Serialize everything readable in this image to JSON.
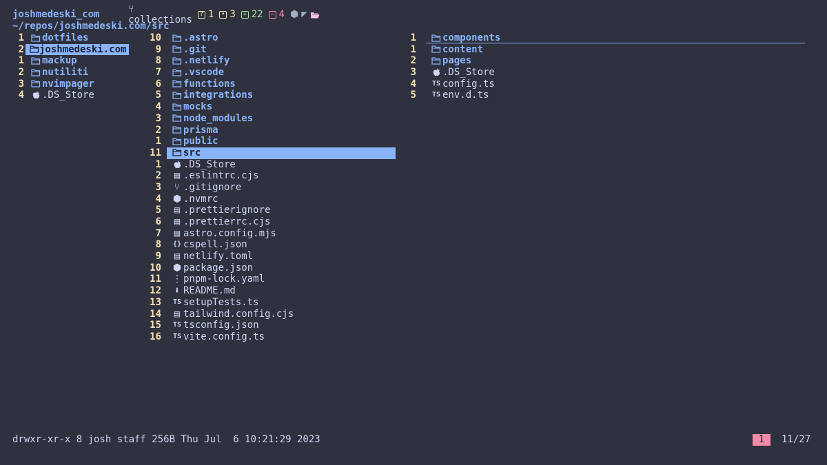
{
  "header": {
    "user_host": "joshmedeski_com",
    "branch_icon": "git-branch-icon",
    "branch": "collections",
    "stats": [
      {
        "icon": "untracked-icon",
        "value": "1",
        "color": "#f9e2af"
      },
      {
        "icon": "modified-icon",
        "value": "3",
        "color": "#f9e2af"
      },
      {
        "icon": "added-icon",
        "value": "22",
        "color": "#a6e3a1"
      },
      {
        "icon": "deleted-icon",
        "value": "4",
        "color": "#f38ba8"
      }
    ],
    "extra_icons": [
      "node-icon",
      "vite-icon",
      "folder-open-icon"
    ]
  },
  "path": "~/repos/joshmedeski.com/src",
  "parent_column": {
    "items": [
      {
        "num": "1",
        "icon": "folder",
        "name": "dotfiles",
        "type": "dir"
      },
      {
        "num": "2",
        "icon": "folder",
        "name": "joshmedeski.com",
        "type": "dir",
        "selected": true
      },
      {
        "num": "1",
        "icon": "folder",
        "name": "mackup",
        "type": "dir"
      },
      {
        "num": "2",
        "icon": "folder",
        "name": "nutiliti",
        "type": "dir"
      },
      {
        "num": "3",
        "icon": "folder",
        "name": "nvimpager",
        "type": "dir"
      },
      {
        "num": "4",
        "icon": "apple",
        "name": ".DS_Store",
        "type": "file"
      }
    ]
  },
  "current_column": {
    "items": [
      {
        "num": "10",
        "icon": "folder",
        "name": ".astro",
        "type": "dir"
      },
      {
        "num": "9",
        "icon": "folder",
        "name": ".git",
        "type": "dir"
      },
      {
        "num": "8",
        "icon": "folder",
        "name": ".netlify",
        "type": "dir"
      },
      {
        "num": "7",
        "icon": "folder",
        "name": ".vscode",
        "type": "dir"
      },
      {
        "num": "6",
        "icon": "folder",
        "name": "functions",
        "type": "dir"
      },
      {
        "num": "5",
        "icon": "folder",
        "name": "integrations",
        "type": "dir"
      },
      {
        "num": "4",
        "icon": "folder",
        "name": "mocks",
        "type": "dir"
      },
      {
        "num": "3",
        "icon": "folder",
        "name": "node_modules",
        "type": "dir"
      },
      {
        "num": "2",
        "icon": "folder",
        "name": "prisma",
        "type": "dir"
      },
      {
        "num": "1",
        "icon": "folder",
        "name": "public",
        "type": "dir"
      },
      {
        "num": "11",
        "icon": "folder",
        "name": "src",
        "type": "dir",
        "selected": true
      },
      {
        "num": "1",
        "icon": "apple",
        "name": ".DS_Store",
        "type": "file"
      },
      {
        "num": "2",
        "icon": "file",
        "name": ".eslintrc.cjs",
        "type": "file"
      },
      {
        "num": "3",
        "icon": "git",
        "name": ".gitignore",
        "type": "file"
      },
      {
        "num": "4",
        "icon": "node",
        "name": ".nvmrc",
        "type": "file"
      },
      {
        "num": "5",
        "icon": "file",
        "name": ".prettierignore",
        "type": "file"
      },
      {
        "num": "6",
        "icon": "file",
        "name": ".prettierrc.cjs",
        "type": "file"
      },
      {
        "num": "7",
        "icon": "file",
        "name": "astro.config.mjs",
        "type": "file"
      },
      {
        "num": "8",
        "icon": "json",
        "name": "cspell.json",
        "type": "file"
      },
      {
        "num": "9",
        "icon": "file",
        "name": "netlify.toml",
        "type": "file"
      },
      {
        "num": "10",
        "icon": "node",
        "name": "package.json",
        "type": "file"
      },
      {
        "num": "11",
        "icon": "yaml",
        "name": "pnpm-lock.yaml",
        "type": "file"
      },
      {
        "num": "12",
        "icon": "markdown",
        "name": "README.md",
        "type": "file"
      },
      {
        "num": "13",
        "icon": "ts",
        "name": "setupTests.ts",
        "type": "file"
      },
      {
        "num": "14",
        "icon": "file",
        "name": "tailwind.config.cjs",
        "type": "file"
      },
      {
        "num": "15",
        "icon": "ts",
        "name": "tsconfig.json",
        "type": "file"
      },
      {
        "num": "16",
        "icon": "ts",
        "name": "vite.config.ts",
        "type": "file"
      }
    ]
  },
  "preview_column": {
    "items": [
      {
        "num": "1",
        "icon": "folder",
        "name": "components",
        "type": "dir",
        "underlined": true
      },
      {
        "num": "1",
        "icon": "folder",
        "name": "content",
        "type": "dir"
      },
      {
        "num": "2",
        "icon": "folder",
        "name": "pages",
        "type": "dir"
      },
      {
        "num": "3",
        "icon": "apple",
        "name": ".DS_Store",
        "type": "file"
      },
      {
        "num": "4",
        "icon": "ts",
        "name": "config.ts",
        "type": "file"
      },
      {
        "num": "5",
        "icon": "ts",
        "name": "env.d.ts",
        "type": "file"
      }
    ]
  },
  "statusbar": {
    "file_info": "drwxr-xr-x 8 josh staff 256B Thu Jul  6 10:21:29 2023",
    "badge": "1",
    "position": "11/27"
  }
}
